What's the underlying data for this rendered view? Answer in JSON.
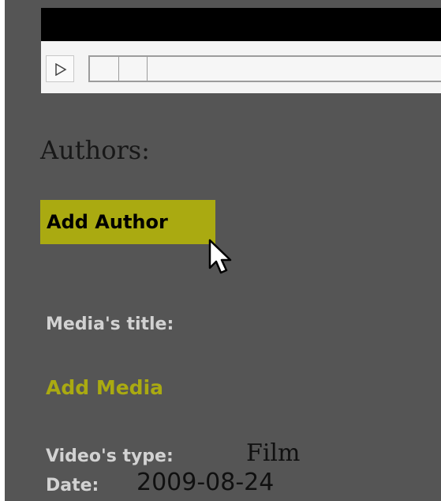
{
  "player": {
    "play_icon": "play-icon"
  },
  "authors": {
    "heading": "Authors:",
    "add_button_label": "Add Author"
  },
  "media": {
    "title_label": "Media's title:",
    "add_link_label": "Add Media"
  },
  "video": {
    "type_label": "Video's type:",
    "type_value": "Film",
    "date_label": "Date:",
    "date_value": "2009-08-24"
  },
  "colors": {
    "panel_background": "#555555",
    "accent": "#aaaa11",
    "label_text": "#d2d2d2"
  }
}
